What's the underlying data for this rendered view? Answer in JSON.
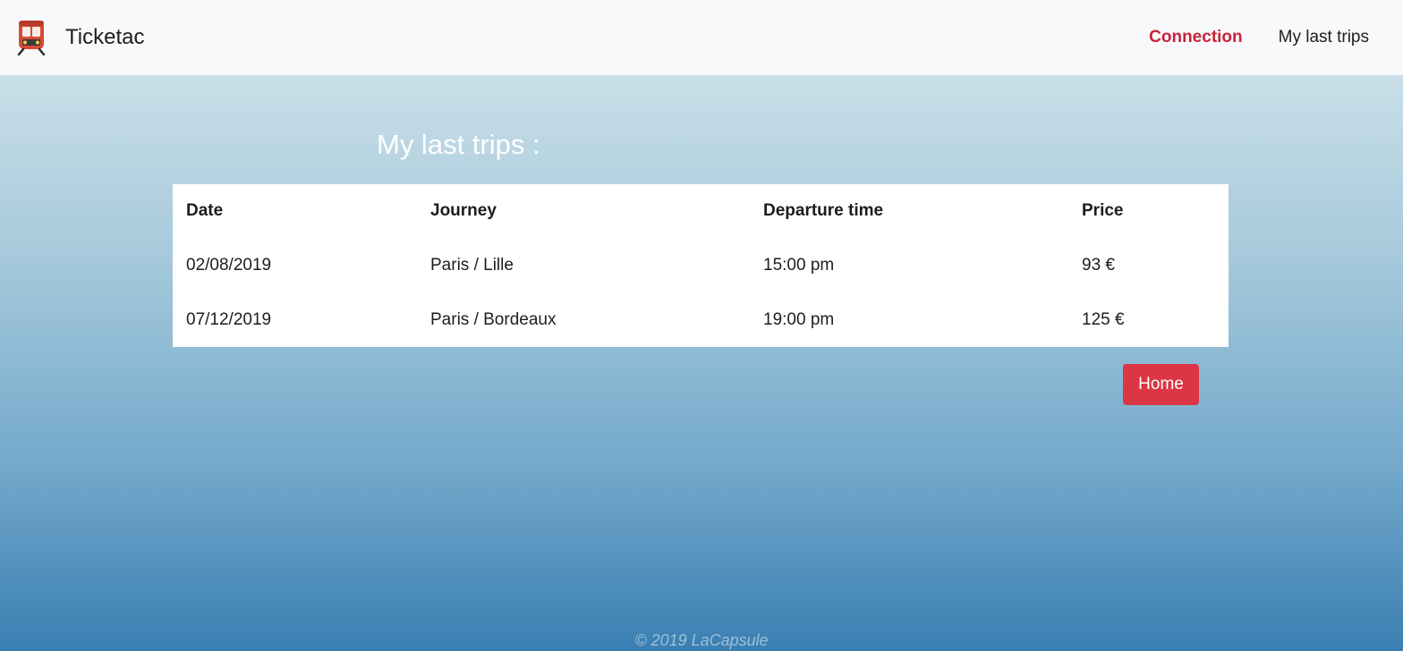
{
  "navbar": {
    "brand_icon": "train-icon",
    "brand_name": "Ticketac",
    "links": [
      {
        "label": "Connection",
        "active": true
      },
      {
        "label": "My last trips",
        "active": false
      }
    ]
  },
  "main": {
    "title": "My last trips :",
    "table": {
      "headers": [
        "Date",
        "Journey",
        "Departure time",
        "Price"
      ],
      "rows": [
        [
          "02/08/2019",
          "Paris / Lille",
          "15:00 pm",
          "93 €"
        ],
        [
          "07/12/2019",
          "Paris / Bordeaux",
          "19:00 pm",
          "125 €"
        ]
      ]
    },
    "home_button": "Home"
  },
  "footer": {
    "text": "© 2019 LaCapsule"
  },
  "colors": {
    "accent": "#c8233c",
    "button": "#dc3545",
    "navbar_bg": "#f8f9fb"
  }
}
